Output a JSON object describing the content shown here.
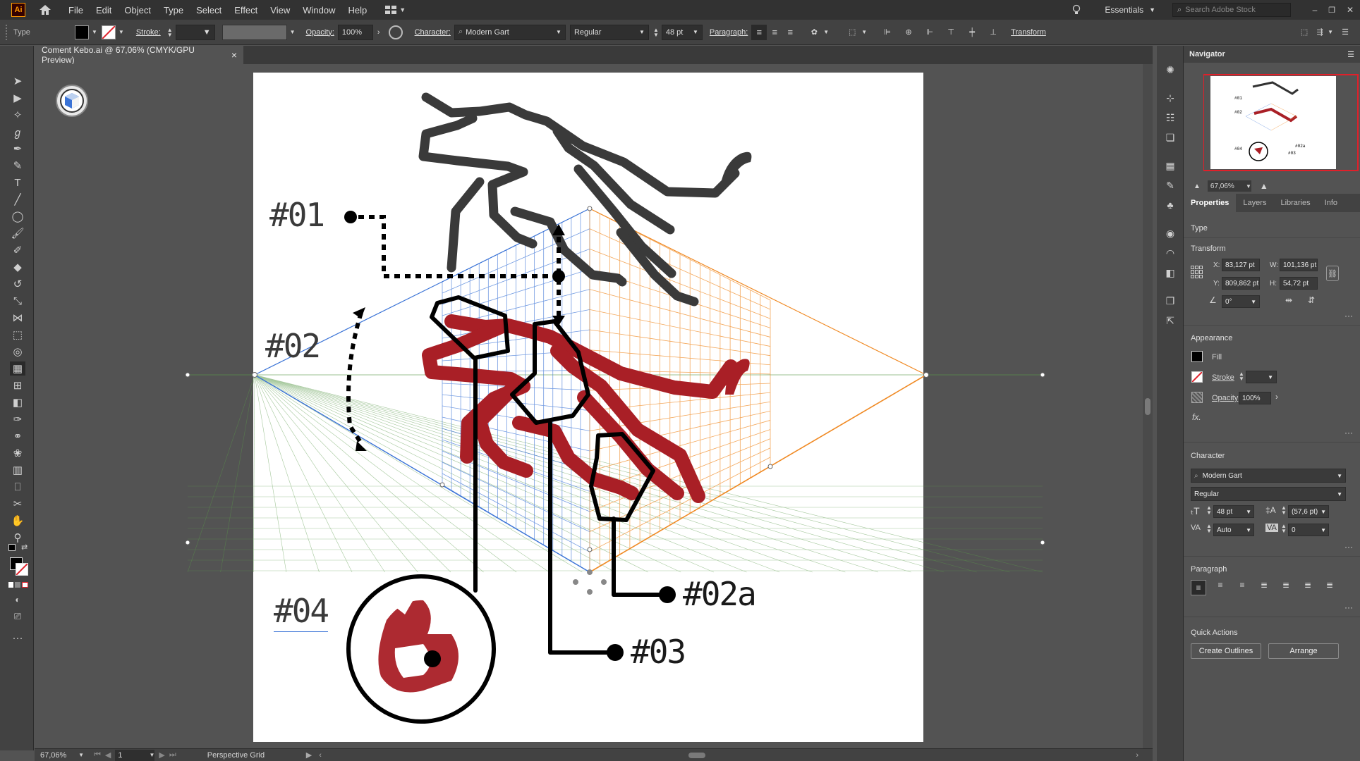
{
  "app": {
    "logo": "Ai",
    "workspace": "Essentials",
    "search_placeholder": "Search Adobe Stock"
  },
  "menu": [
    "File",
    "Edit",
    "Object",
    "Type",
    "Select",
    "Effect",
    "View",
    "Window",
    "Help"
  ],
  "control_bar": {
    "type_label": "Type",
    "stroke_label": "Stroke:",
    "opacity_label": "Opacity:",
    "opacity_value": "100%",
    "character_label": "Character:",
    "font": "Modern Gart",
    "font_style": "Regular",
    "font_size": "48 pt",
    "paragraph_label": "Paragraph:",
    "transform_label": "Transform"
  },
  "document": {
    "tab_title": "Coment Kebo.ai @ 67,06% (CMYK/GPU Preview)",
    "close_glyph": "×"
  },
  "artwork": {
    "labels": [
      "#01",
      "#02",
      "#02a",
      "#03",
      "#04"
    ]
  },
  "status_bar": {
    "zoom": "67,06%",
    "artboard_num": "1",
    "tool_name": "Perspective Grid"
  },
  "navigator": {
    "title": "Navigator",
    "zoom": "67,06%"
  },
  "properties": {
    "tabs": [
      "Properties",
      "Layers",
      "Libraries",
      "Info"
    ],
    "type_label": "Type",
    "transform": {
      "title": "Transform",
      "x_label": "X:",
      "x": "83,127 pt",
      "y_label": "Y:",
      "y": "809,862 pt",
      "w_label": "W:",
      "w": "101,136 pt",
      "h_label": "H:",
      "h": "54,72 pt",
      "angle": "0°"
    },
    "appearance": {
      "title": "Appearance",
      "fill_label": "Fill",
      "stroke_label": "Stroke",
      "opacity_label": "Opacity",
      "opacity": "100%",
      "fx": "fx."
    },
    "character": {
      "title": "Character",
      "font": "Modern Gart",
      "style": "Regular",
      "size": "48 pt",
      "leading": "(57,6 pt)",
      "kerning": "Auto",
      "tracking": "0"
    },
    "paragraph": {
      "title": "Paragraph"
    },
    "quick_actions": {
      "title": "Quick Actions",
      "create_outlines": "Create Outlines",
      "arrange": "Arrange"
    }
  },
  "colors": {
    "bull_red": "#a91f26",
    "bull_dark": "#3a3a3a",
    "grid_left": "#3a73d6",
    "grid_right": "#f08a24",
    "grid_ground": "#5a9a4a"
  }
}
